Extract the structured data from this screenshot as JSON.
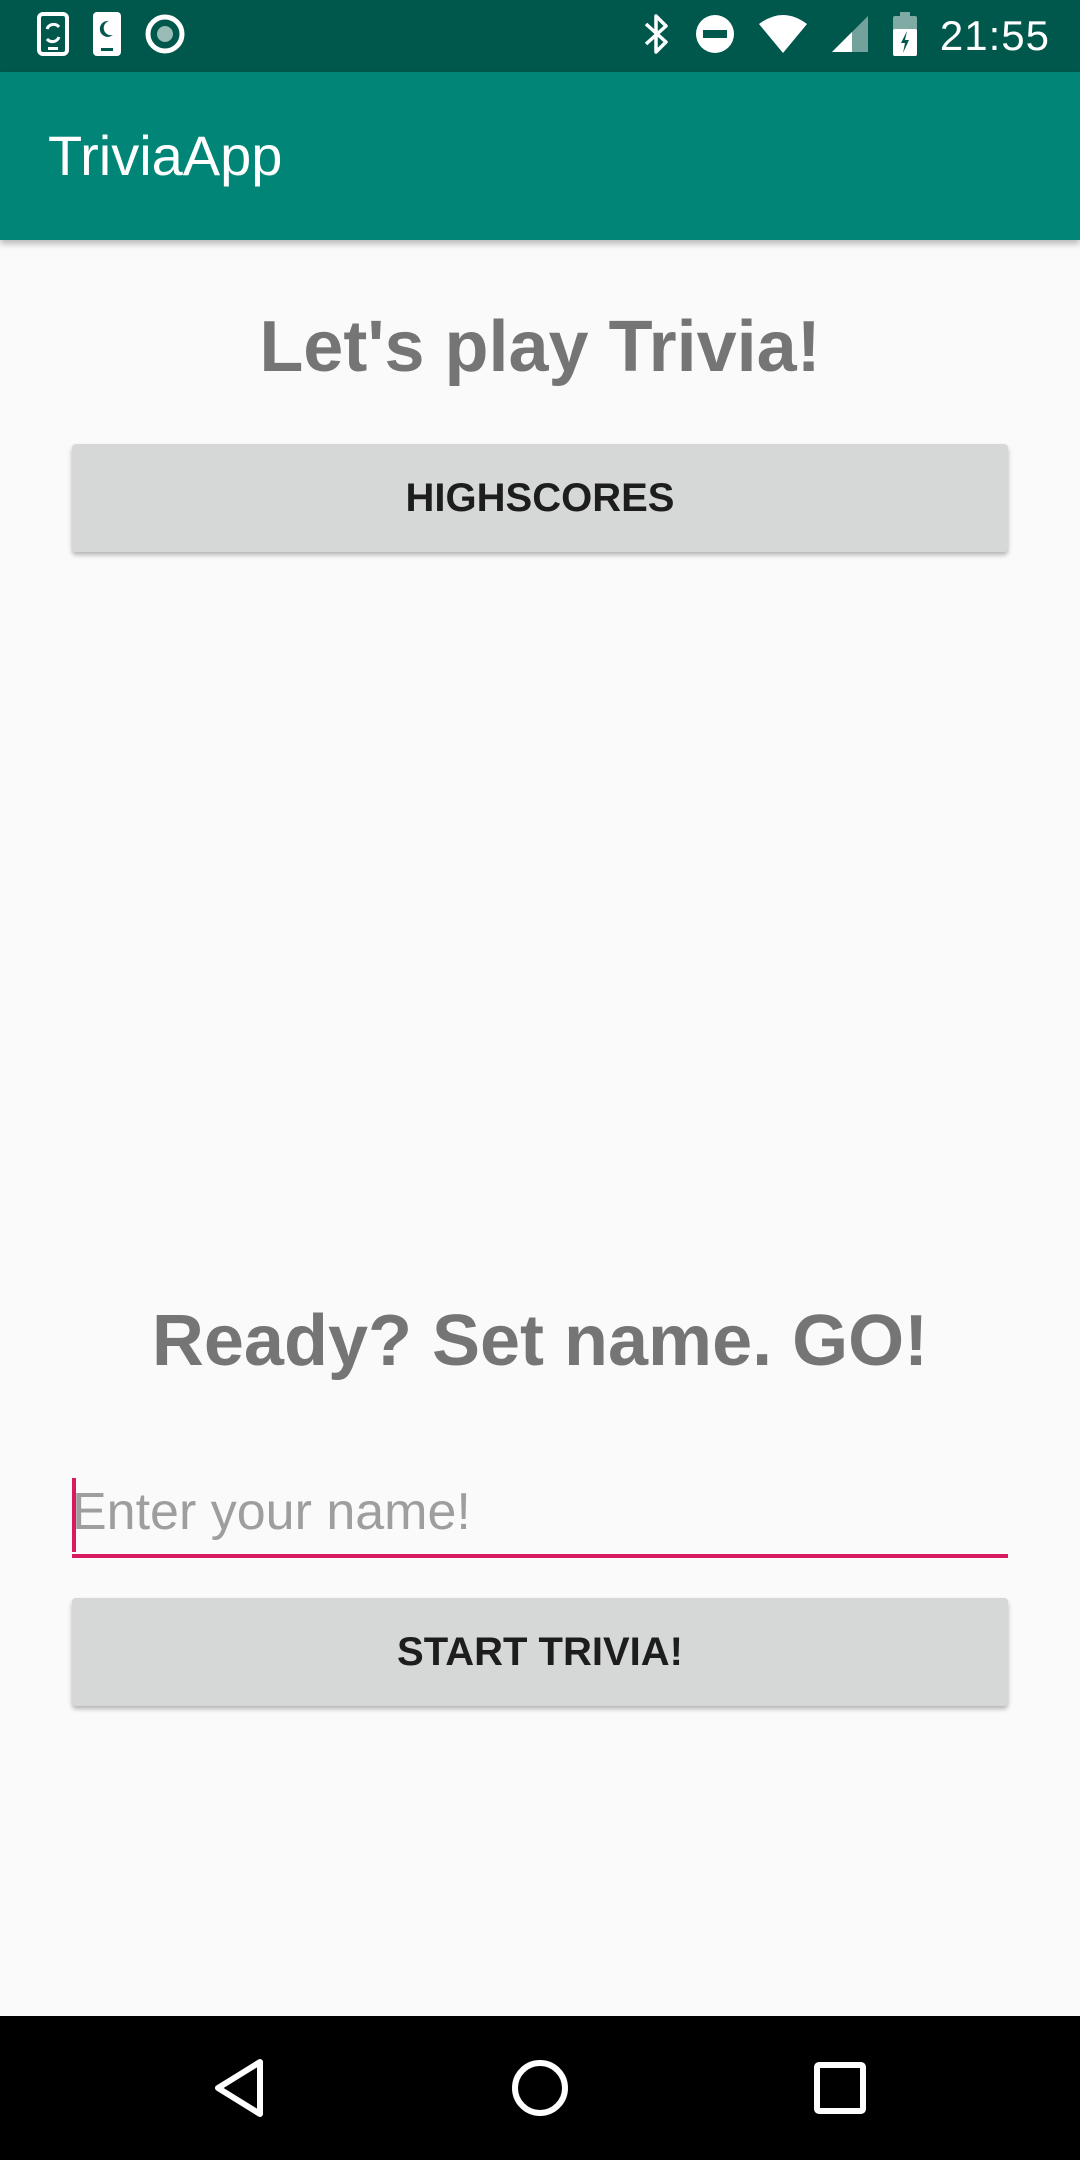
{
  "status_bar": {
    "time": "21:55",
    "icons": [
      "phone-sync-icon",
      "sleep-icon",
      "circle-notification-icon",
      "bluetooth-icon",
      "do-not-disturb-icon",
      "wifi-icon",
      "cell-signal-icon",
      "battery-icon"
    ]
  },
  "app_bar": {
    "title": "TriviaApp"
  },
  "main": {
    "welcome_heading": "Let's play Trivia!",
    "highscores_label": "HIGHSCORES",
    "ready_heading": "Ready? Set name. GO!",
    "name_input": {
      "value": "",
      "placeholder": "Enter your name!"
    },
    "start_label": "START TRIVIA!"
  },
  "nav_bar": {
    "icons": [
      "back-icon",
      "home-icon",
      "recents-icon"
    ]
  },
  "colors": {
    "status_bar": "#00574b",
    "app_bar": "#008577",
    "accent": "#d81b60",
    "background": "#fafafa",
    "heading_text": "#757575",
    "button_bg": "#d6d7d7"
  }
}
